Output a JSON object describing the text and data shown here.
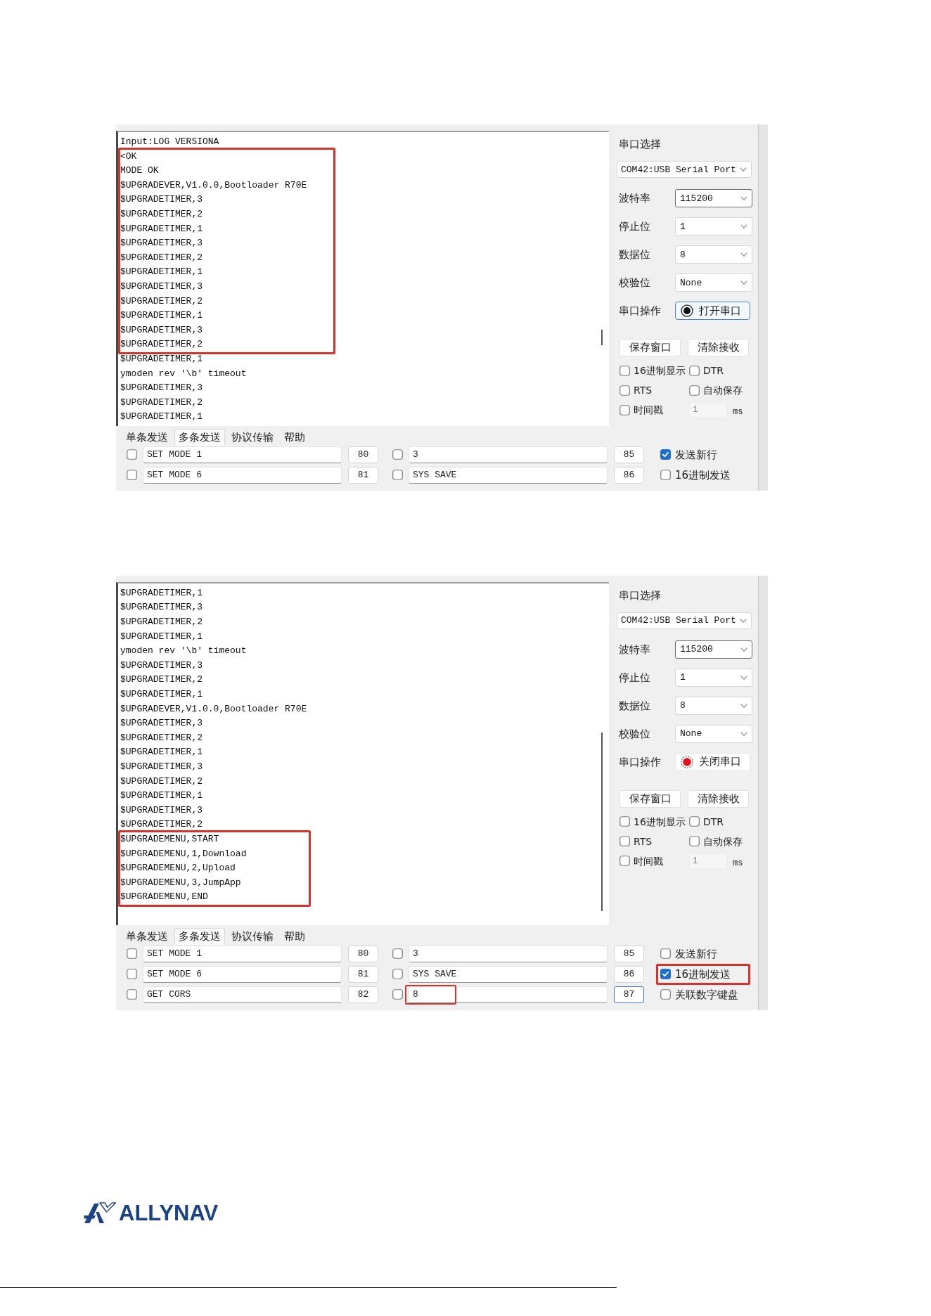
{
  "screenshots": [
    {
      "log": {
        "blocks": [
          {
            "highlighted": false,
            "lines": [
              "Input:LOG VERSIONA"
            ]
          },
          {
            "highlighted": true,
            "lines": [
              "<OK",
              "MODE OK",
              "$UPGRADEVER,V1.0.0,Bootloader R70E",
              "$UPGRADETIMER,3",
              "$UPGRADETIMER,2",
              "$UPGRADETIMER,1",
              "$UPGRADETIMER,3",
              "$UPGRADETIMER,2",
              "$UPGRADETIMER,1",
              "$UPGRADETIMER,3",
              "$UPGRADETIMER,2",
              "$UPGRADETIMER,1",
              "$UPGRADETIMER,3",
              "$UPGRADETIMER,2"
            ]
          },
          {
            "highlighted": false,
            "lines": [
              "$UPGRADETIMER,1",
              "ymoden rev '\\b' timeout",
              "$UPGRADETIMER,3",
              "$UPGRADETIMER,2",
              "$UPGRADETIMER,1"
            ]
          }
        ]
      },
      "panel": {
        "port_section_label": "串口选择",
        "port": "COM42:USB Serial Port",
        "settings": [
          {
            "label": "波特率",
            "value": "115200",
            "focused": true
          },
          {
            "label": "停止位",
            "value": "1",
            "focused": false
          },
          {
            "label": "数据位",
            "value": "8",
            "focused": false
          },
          {
            "label": "校验位",
            "value": "None",
            "focused": false
          }
        ],
        "operation": {
          "label": "串口操作",
          "button": "打开串口",
          "port_open": false,
          "focused": true
        },
        "buttons": [
          "保存窗口",
          "清除接收"
        ],
        "options": [
          {
            "label": "16进制显示",
            "checked": false
          },
          {
            "label": "DTR",
            "checked": false
          },
          {
            "label": "RTS",
            "checked": false
          },
          {
            "label": "自动保存",
            "checked": false
          },
          {
            "label": "时间戳",
            "checked": false
          }
        ],
        "interval": {
          "value": "1",
          "unit": "ms",
          "disabled": true
        }
      },
      "tabs": [
        {
          "label": "单条发送",
          "selected": false
        },
        {
          "label": "多条发送",
          "selected": true
        },
        {
          "label": "协议传输",
          "selected": false
        },
        {
          "label": "帮助",
          "selected": false
        }
      ],
      "send_rows": [
        {
          "items": [
            {
              "checked": false,
              "text": "SET MODE 1",
              "number": "80",
              "highlighted": false,
              "focused": false
            },
            {
              "checked": false,
              "text": "3",
              "number": "85",
              "highlighted": false,
              "focused": false
            }
          ]
        },
        {
          "items": [
            {
              "checked": false,
              "text": "SET MODE 6",
              "number": "81",
              "highlighted": false,
              "focused": false
            },
            {
              "checked": false,
              "text": "SYS SAVE",
              "number": "86",
              "highlighted": false,
              "focused": false
            }
          ]
        }
      ],
      "send_options": [
        {
          "label": "发送新行",
          "checked": true,
          "highlighted": false
        },
        {
          "label": "16进制发送",
          "checked": false,
          "highlighted": false
        }
      ]
    },
    {
      "log": {
        "blocks": [
          {
            "highlighted": false,
            "lines": [
              "$UPGRADETIMER,1",
              "$UPGRADETIMER,3",
              "$UPGRADETIMER,2",
              "$UPGRADETIMER,1",
              "ymoden rev '\\b' timeout",
              "$UPGRADETIMER,3",
              "$UPGRADETIMER,2",
              "$UPGRADETIMER,1",
              "$UPGRADEVER,V1.0.0,Bootloader R70E",
              "$UPGRADETIMER,3",
              "$UPGRADETIMER,2",
              "$UPGRADETIMER,1",
              "$UPGRADETIMER,3",
              "$UPGRADETIMER,2",
              "$UPGRADETIMER,1",
              "$UPGRADETIMER,3",
              "$UPGRADETIMER,2"
            ]
          },
          {
            "highlighted": true,
            "lines": [
              "$UPGRADEMENU,START",
              "$UPGRADEMENU,1,Download",
              "$UPGRADEMENU,2,Upload",
              "$UPGRADEMENU,3,JumpApp",
              "$UPGRADEMENU,END"
            ]
          }
        ]
      },
      "panel": {
        "port_section_label": "串口选择",
        "port": "COM42:USB Serial Port",
        "settings": [
          {
            "label": "波特率",
            "value": "115200",
            "focused": true
          },
          {
            "label": "停止位",
            "value": "1",
            "focused": false
          },
          {
            "label": "数据位",
            "value": "8",
            "focused": false
          },
          {
            "label": "校验位",
            "value": "None",
            "focused": false
          }
        ],
        "operation": {
          "label": "串口操作",
          "button": "关闭串口",
          "port_open": true,
          "focused": false
        },
        "buttons": [
          "保存窗口",
          "清除接收"
        ],
        "options": [
          {
            "label": "16进制显示",
            "checked": false
          },
          {
            "label": "DTR",
            "checked": false
          },
          {
            "label": "RTS",
            "checked": false
          },
          {
            "label": "自动保存",
            "checked": false
          },
          {
            "label": "时间戳",
            "checked": false
          }
        ],
        "interval": {
          "value": "1",
          "unit": "ms",
          "disabled": true
        }
      },
      "tabs": [
        {
          "label": "单条发送",
          "selected": false
        },
        {
          "label": "多条发送",
          "selected": true
        },
        {
          "label": "协议传输",
          "selected": false
        },
        {
          "label": "帮助",
          "selected": false
        }
      ],
      "send_rows": [
        {
          "items": [
            {
              "checked": false,
              "text": "SET MODE 1",
              "number": "80",
              "highlighted": false,
              "focused": false
            },
            {
              "checked": false,
              "text": "3",
              "number": "85",
              "highlighted": false,
              "focused": false
            }
          ]
        },
        {
          "items": [
            {
              "checked": false,
              "text": "SET MODE 6",
              "number": "81",
              "highlighted": false,
              "focused": false
            },
            {
              "checked": false,
              "text": "SYS SAVE",
              "number": "86",
              "highlighted": false,
              "focused": false
            }
          ]
        },
        {
          "items": [
            {
              "checked": false,
              "text": "GET CORS",
              "number": "82",
              "highlighted": false,
              "focused": false
            },
            {
              "checked": false,
              "text": "8",
              "number": "87",
              "highlighted": true,
              "focused": true
            }
          ]
        }
      ],
      "send_options": [
        {
          "label": "发送新行",
          "checked": false,
          "highlighted": false
        },
        {
          "label": "16进制发送",
          "checked": true,
          "highlighted": true
        },
        {
          "label": "关联数字键盘",
          "checked": false,
          "highlighted": false
        }
      ]
    }
  ],
  "logo": {
    "text": "ALLYNAV"
  }
}
